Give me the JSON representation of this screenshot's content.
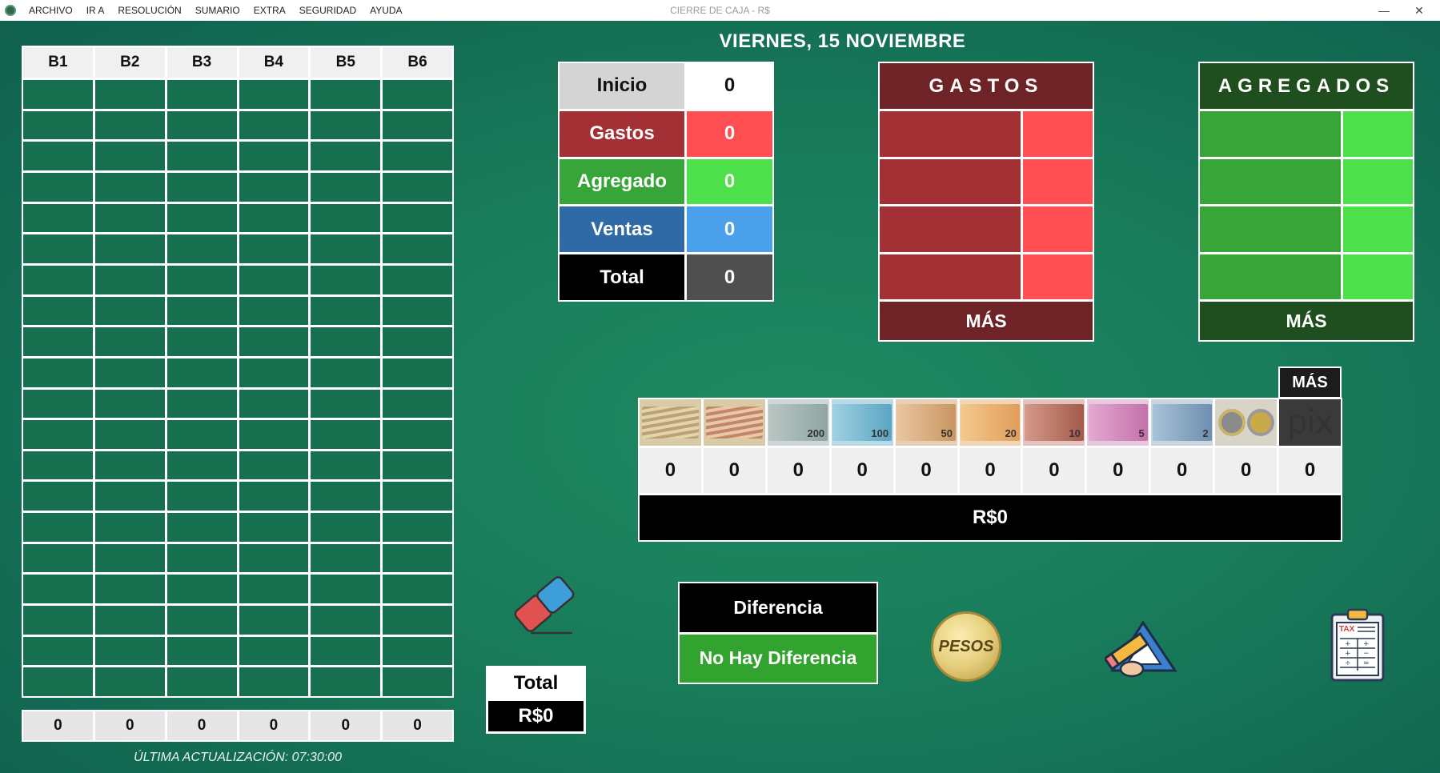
{
  "window": {
    "title": "CIERRE DE CAJA - R$",
    "menu": [
      "ARCHIVO",
      "IR A",
      "RESOLUCIÓN",
      "SUMARIO",
      "EXTRA",
      "SEGURIDAD",
      "AYUDA"
    ],
    "minimize": "—",
    "close": "✕"
  },
  "date": "VIERNES, 15 NOVIEMBRE",
  "bgrid": {
    "headers": [
      "B1",
      "B2",
      "B3",
      "B4",
      "B5",
      "B6"
    ],
    "totals": [
      "0",
      "0",
      "0",
      "0",
      "0",
      "0"
    ],
    "last_update": "ÚLTIMA ACTUALIZACIÓN: 07:30:00"
  },
  "summary": {
    "rows": [
      {
        "label": "Inicio",
        "value": "0"
      },
      {
        "label": "Gastos",
        "value": "0"
      },
      {
        "label": "Agregado",
        "value": "0"
      },
      {
        "label": "Ventas",
        "value": "0"
      },
      {
        "label": "Total",
        "value": "0"
      }
    ],
    "colors": {
      "inicio_label_bg": "#d4d4d4",
      "inicio_value_bg": "#ffffff",
      "gastos_label_bg": "#a33034",
      "gastos_value_bg": "#ff4f52",
      "agregado_label_bg": "#38a538",
      "agregado_value_bg": "#4ee04a",
      "ventas_label_bg": "#2f6aa6",
      "ventas_value_bg": "#4aa0ea",
      "total_label_bg": "#000000",
      "total_value_bg": "#4f4f4f"
    }
  },
  "gastos": {
    "title": "GASTOS",
    "more": "MÁS"
  },
  "agregados": {
    "title": "AGREGADOS",
    "more": "MÁS"
  },
  "money": {
    "more": "MÁS",
    "denominations": [
      {
        "icon": "bundle-icon",
        "label": ""
      },
      {
        "icon": "bundle-icon",
        "label": ""
      },
      {
        "icon": "note-200-icon",
        "label": "200"
      },
      {
        "icon": "note-100-icon",
        "label": "100"
      },
      {
        "icon": "note-50-icon",
        "label": "50"
      },
      {
        "icon": "note-20-icon",
        "label": "20"
      },
      {
        "icon": "note-10-icon",
        "label": "10"
      },
      {
        "icon": "note-5-icon",
        "label": "5"
      },
      {
        "icon": "note-2-icon",
        "label": "2"
      },
      {
        "icon": "coins-icon",
        "label": ""
      },
      {
        "icon": "pix-icon",
        "label": "pix"
      }
    ],
    "counts": [
      "0",
      "0",
      "0",
      "0",
      "0",
      "0",
      "0",
      "0",
      "0",
      "0",
      "0"
    ],
    "total": "R$0"
  },
  "total_box": {
    "label": "Total",
    "value": "R$0"
  },
  "difference": {
    "label": "Diferencia",
    "status": "No Hay Diferencia"
  },
  "pesos_coin": {
    "text": "PESOS"
  },
  "tax_clip": {
    "text": "TAX"
  }
}
